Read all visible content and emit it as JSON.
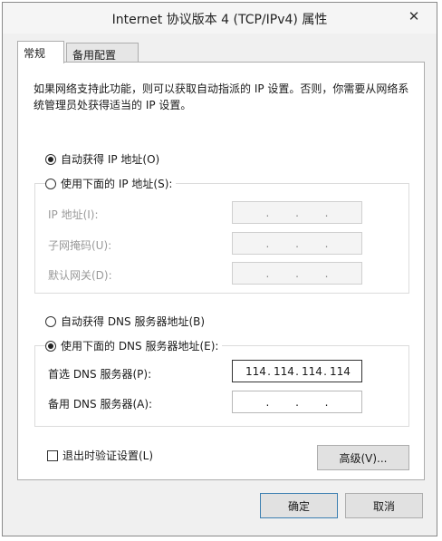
{
  "window": {
    "title": "Internet 协议版本 4 (TCP/IPv4) 属性",
    "close_glyph": "✕"
  },
  "tabs": [
    {
      "label": "常规",
      "active": true
    },
    {
      "label": "备用配置",
      "active": false
    }
  ],
  "description": "如果网络支持此功能，则可以获取自动指派的 IP 设置。否则，你需要从网络系统管理员处获得适当的 IP 设置。",
  "ip": {
    "auto_label": "自动获得 IP 地址(O)",
    "auto_selected": true,
    "manual_label": "使用下面的 IP 地址(S):",
    "manual_selected": false,
    "address_label": "IP 地址(I):",
    "mask_label": "子网掩码(U):",
    "gateway_label": "默认网关(D):",
    "address": [
      "",
      "",
      "",
      ""
    ],
    "mask": [
      "",
      "",
      "",
      ""
    ],
    "gateway": [
      "",
      "",
      "",
      ""
    ]
  },
  "dns": {
    "auto_label": "自动获得 DNS 服务器地址(B)",
    "auto_selected": false,
    "manual_label": "使用下面的 DNS 服务器地址(E):",
    "manual_selected": true,
    "preferred_label": "首选 DNS 服务器(P):",
    "alternate_label": "备用 DNS 服务器(A):",
    "preferred": [
      "114",
      "114",
      "114",
      "114"
    ],
    "alternate": [
      "",
      "",
      "",
      ""
    ]
  },
  "validate_label": "退出时验证设置(L)",
  "validate_checked": false,
  "advanced_label": "高级(V)...",
  "ok_label": "确定",
  "cancel_label": "取消",
  "ip_separator": "."
}
